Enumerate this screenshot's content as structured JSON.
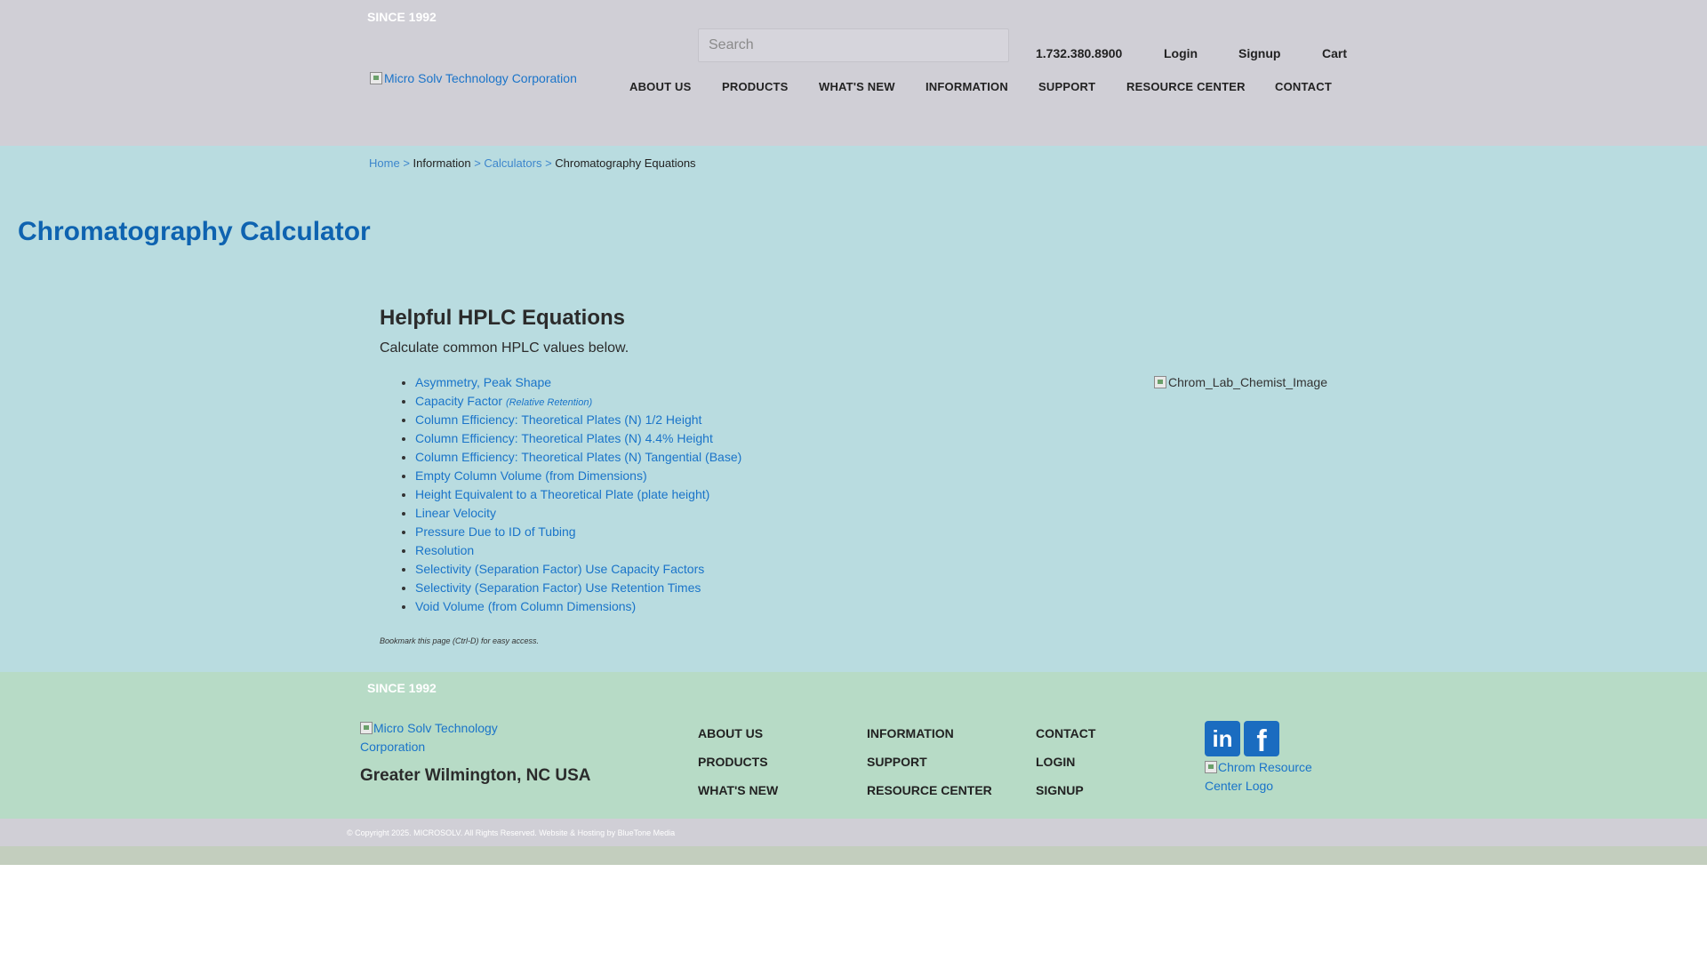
{
  "header": {
    "since": "SINCE 1992",
    "logo_alt": "Micro Solv Technology Corporation",
    "search_placeholder": "Search",
    "phone": "1.732.380.8900",
    "login": "Login",
    "signup": "Signup",
    "cart": "Cart",
    "nav": [
      "ABOUT US",
      "PRODUCTS",
      "WHAT'S NEW",
      "INFORMATION",
      "SUPPORT",
      "RESOURCE CENTER",
      "CONTACT"
    ]
  },
  "breadcrumb": {
    "home": "Home",
    "information": "Information",
    "calculators": "Calculators",
    "current": "Chromatography Equations",
    "separator": ">"
  },
  "main": {
    "title": "Chromatography Calculator",
    "heading": "Helpful HPLC Equations",
    "intro": "Calculate common HPLC values below.",
    "capacity_note": "(Relative Retention)",
    "items": [
      "Asymmetry, Peak Shape",
      "Capacity Factor",
      "Column Efficiency: Theoretical Plates (N) 1/2 Height",
      "Column Efficiency: Theoretical Plates (N) 4.4% Height",
      "Column Efficiency: Theoretical Plates (N) Tangential (Base)",
      "Empty Column Volume (from Dimensions)",
      "Height Equivalent to a Theoretical Plate (plate height)",
      "Linear Velocity",
      "Pressure Due to ID of Tubing",
      "Resolution",
      "Selectivity (Separation Factor) Use Capacity Factors",
      "Selectivity (Separation Factor) Use Retention Times",
      "Void Volume (from Column Dimensions)"
    ],
    "bookmark_note": "Bookmark this page (Ctrl-D) for easy access.",
    "image_alt": "Chrom_Lab_Chemist_Image"
  },
  "footer": {
    "since": "SINCE 1992",
    "logo_alt": "Micro Solv Technology Corporation",
    "location": "Greater Wilmington, NC USA",
    "col1": [
      "ABOUT US",
      "PRODUCTS",
      "WHAT'S NEW"
    ],
    "col2": [
      "INFORMATION",
      "SUPPORT",
      "RESOURCE CENTER"
    ],
    "col3": [
      "CONTACT",
      "LOGIN",
      "SIGNUP"
    ],
    "linkedin_glyph": "in",
    "facebook_glyph": "f",
    "chrom_logo_alt": "Chrom Resource Center Logo",
    "copyright": "© Copyright 2025. MICROSOLV. All Rights Reserved. Website & Hosting by BlueTone Media"
  },
  "colors": {
    "header_bg": "#d0cfd6",
    "main_bg": "#b9dce0",
    "footer_bg": "#b7dbc6",
    "link": "#1a74c9",
    "title": "#0e63b0"
  },
  "icons": [
    "broken-image-icon",
    "linkedin-icon",
    "facebook-icon"
  ]
}
